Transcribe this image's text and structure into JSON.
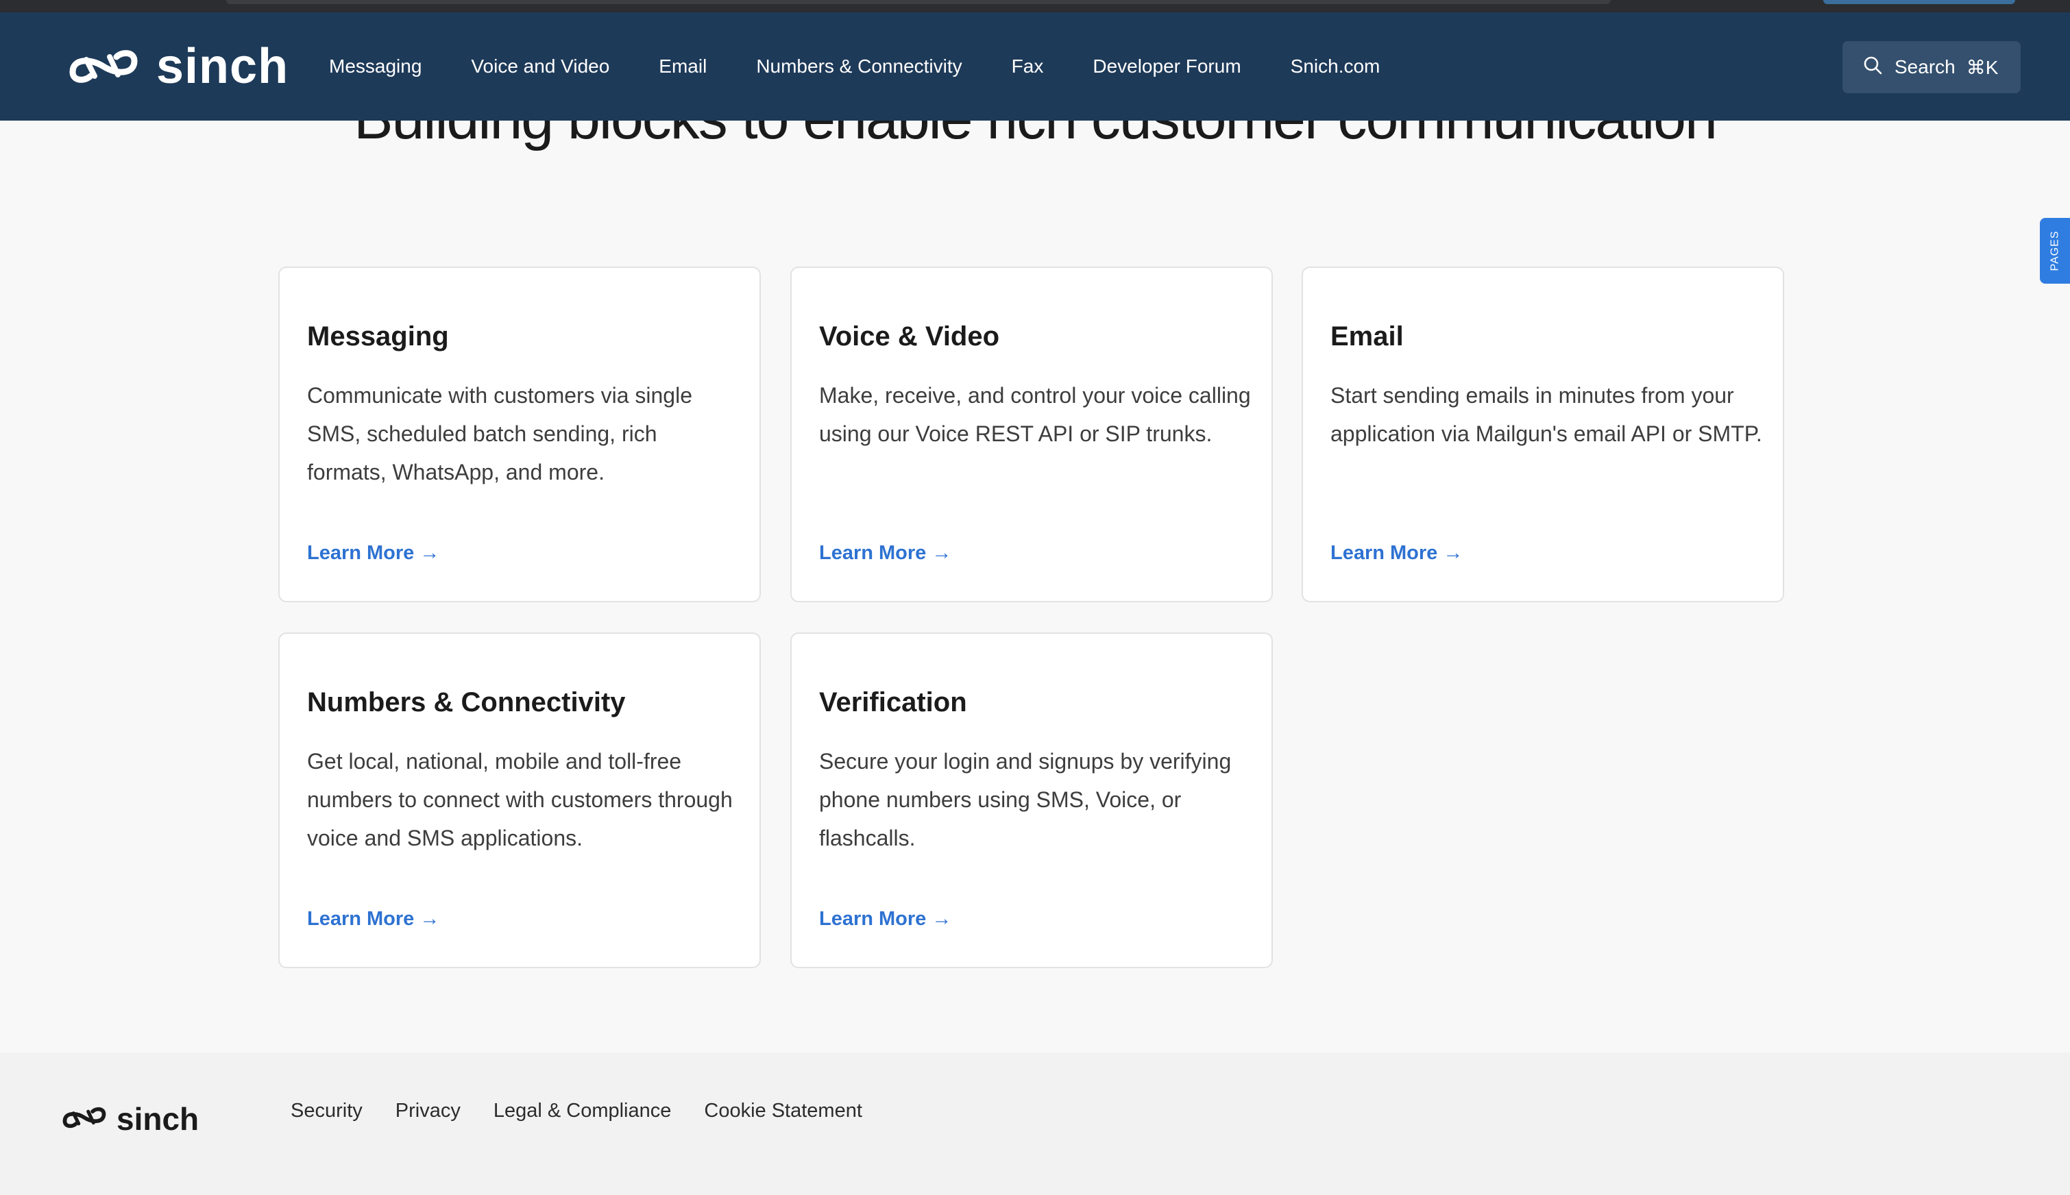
{
  "nav": {
    "logo_text": "sinch",
    "links": [
      "Messaging",
      "Voice and Video",
      "Email",
      "Numbers & Connectivity",
      "Fax",
      "Developer Forum",
      "Snich.com"
    ],
    "search_label": "Search",
    "search_shortcut": "⌘K"
  },
  "hero": {
    "title": "Building blocks to enable rich customer communication"
  },
  "cards": [
    {
      "title": "Messaging",
      "description": "Communicate with customers via single SMS, scheduled batch sending, rich formats, WhatsApp, and more.",
      "link": "Learn More →"
    },
    {
      "title": "Voice & Video",
      "description": "Make, receive, and control your voice calling using our Voice REST API or SIP trunks.",
      "link": "Learn More →"
    },
    {
      "title": "Email",
      "description": "Start sending emails in minutes from your application via Mailgun's email API or SMTP.",
      "link": "Learn More →"
    },
    {
      "title": "Numbers & Connectivity",
      "description": "Get local, national, mobile and toll-free numbers to connect with customers through voice and SMS applications.",
      "link": "Learn More →"
    },
    {
      "title": "Verification",
      "description": "Secure your login and signups by verifying phone numbers using SMS, Voice, or flashcalls.",
      "link": "Learn More →"
    }
  ],
  "side_tab": {
    "label": "PAGES"
  },
  "footer": {
    "logo_text": "sinch",
    "links": [
      "Security",
      "Privacy",
      "Legal & Compliance",
      "Cookie Statement"
    ]
  },
  "colors": {
    "nav_background": "#1e3a59",
    "link_blue": "#2e72d2",
    "side_tab_blue": "#2f7de1",
    "page_background": "#f8f8f8"
  },
  "icons": {
    "logo": "sinch-infinity-logo-icon",
    "search": "magnifier-icon",
    "arrow": "arrow-right-icon"
  }
}
